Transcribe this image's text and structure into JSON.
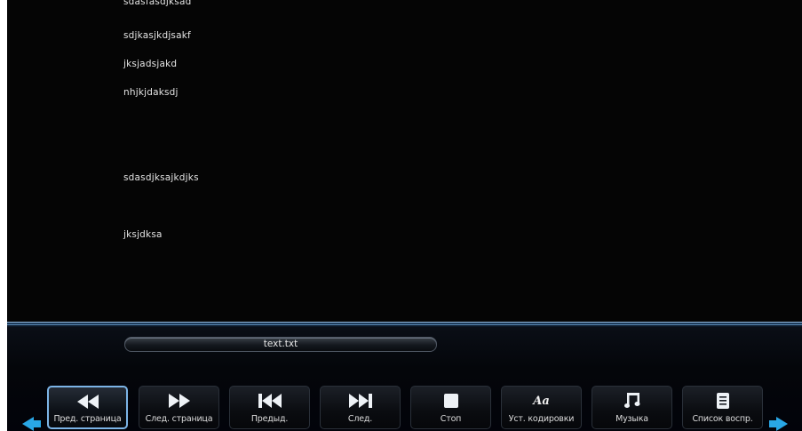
{
  "text_lines": [
    "sdasfasdjksad",
    "sdjkasjkdjsakf",
    "jksjadsjakd",
    "nhjkjdaksdj",
    "sdasdjksajkdjks",
    "jksjdksa"
  ],
  "file": {
    "name": "text.txt"
  },
  "toolbar": {
    "buttons": [
      {
        "label": "Пред. страница",
        "icon": "rewind-icon"
      },
      {
        "label": "След. страница",
        "icon": "fast-forward-icon"
      },
      {
        "label": "Предыд.",
        "icon": "skip-previous-icon"
      },
      {
        "label": "След.",
        "icon": "skip-next-icon"
      },
      {
        "label": "Стоп",
        "icon": "stop-icon"
      },
      {
        "label": "Уст. кодировки",
        "icon": "font-encoding-icon"
      },
      {
        "label": "Музыка",
        "icon": "music-note-icon"
      },
      {
        "label": "Список воспр.",
        "icon": "playlist-icon"
      }
    ],
    "selected_index": 0
  },
  "colors": {
    "accent": "#29a7e6",
    "highlight_border": "#7cb4e6",
    "background": "#050505",
    "text": "#e4e4e4"
  }
}
